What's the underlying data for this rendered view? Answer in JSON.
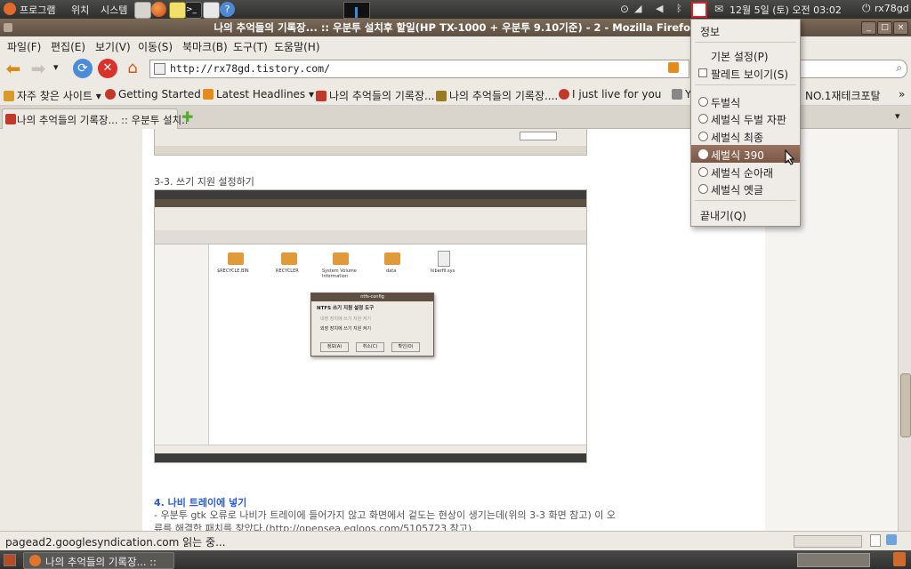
{
  "top_panel": {
    "applications": "프로그램",
    "places": "위치",
    "system": "시스템",
    "clock": "12월  5일 (토) 오전 03:02",
    "user": "rx78gd"
  },
  "window": {
    "title": "나의 추억들의 기록장... :: 우분투 설치후 할일(HP TX-1000 + 우분투 9.10기준) - 2 - Mozilla Firefox",
    "min_label": "_",
    "max_label": "□",
    "close_label": "×"
  },
  "menubar": [
    "파일(F)",
    "편집(E)",
    "보기(V)",
    "이동(S)",
    "북마크(B)",
    "도구(T)",
    "도움말(H)"
  ],
  "urlbar": {
    "value": "http://rx78gd.tistory.com/"
  },
  "bookmarks": [
    {
      "label": "자주 찾은 사이트",
      "icon": "folder-icon",
      "color": "#d99a2b"
    },
    {
      "label": "Getting Started",
      "icon": "firefox-icon",
      "color": "#c0392b"
    },
    {
      "label": "Latest Headlines",
      "icon": "rss-icon",
      "color": "#e58b1e"
    },
    {
      "label": "나의 추억들의 기록장...",
      "icon": "page-icon",
      "color": "#c0392b"
    },
    {
      "label": "나의 추억들의 기록장....",
      "icon": "page-icon",
      "color": "#9a7b1d"
    },
    {
      "label": "I just live for you",
      "icon": "page-icon",
      "color": "#c0392b"
    },
    {
      "label": "Y",
      "icon": "page-icon",
      "color": "#888888"
    },
    {
      "label": "NO.1재테크포탈",
      "icon": "page-icon",
      "color": "#d9a32b"
    }
  ],
  "tabs": [
    {
      "label": "나의 추억들의 기록장... :: 우분투 설치.."
    }
  ],
  "content": {
    "section_title": "3-3. 쓰기 지원 설정하기",
    "screenshot_dialog_title": "ntfs-config",
    "screenshot_dialog_heading": "NTFS 쓰기 지원 설정 도구",
    "screenshot_dialog_opt1": "내장 장치에 쓰기 지원 켜기",
    "screenshot_dialog_opt2": "외장 장치에 쓰기 지원 켜기",
    "screenshot_dialog_buttons": [
      "정보(A)",
      "취소(C)",
      "확인(O)"
    ],
    "screenshot_folders": [
      "$RECYCLE.BIN",
      "RECYCLER",
      "System Volume Information",
      "data",
      "hiberfil.sys"
    ],
    "heading4": "4. 나비 트레이에 넣기",
    "para1": "- 우분투 gtk 오류로 나비가 트레이에 들어가지 않고 화면에서 겉도는 현상이 생기는데(위의 3-3 화면 참고) 이 오",
    "para2": "류를 해결한 패치를 찾았다.(http://opensea.egloos.com/5105723 참고)"
  },
  "statusbar": {
    "text": "pagead2.googlesyndication.com 읽는 중..."
  },
  "taskbar": {
    "task_label": "나의 추억들의 기록장... ::"
  },
  "dropdown": {
    "info": "정보",
    "preferences": "기본 설정(P)",
    "show_palette": "팔레트 보이기(S)",
    "layouts": [
      "두벌식",
      "세벌식 두벌 자판",
      "세벌식 최종",
      "세벌식 390",
      "세벌식 순아래",
      "세벌식 옛글"
    ],
    "selected_index": 3,
    "quit": "끝내기(Q)"
  },
  "colors": {
    "panel": "#3c3c3a",
    "titlebar": "#6b5a4b",
    "accent": "#8a6552",
    "link_heading": "#2a5bd7"
  }
}
